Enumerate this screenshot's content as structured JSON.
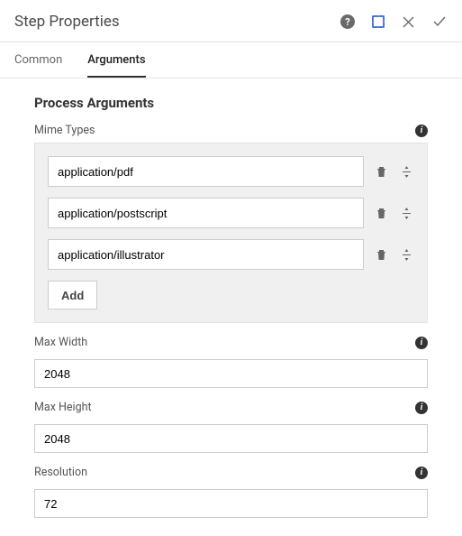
{
  "header": {
    "title": "Step Properties"
  },
  "tabs": {
    "common": "Common",
    "arguments": "Arguments"
  },
  "section": {
    "title": "Process Arguments"
  },
  "mimeTypes": {
    "label": "Mime Types",
    "items": [
      "application/pdf",
      "application/postscript",
      "application/illustrator"
    ],
    "addLabel": "Add"
  },
  "maxWidth": {
    "label": "Max Width",
    "value": "2048"
  },
  "maxHeight": {
    "label": "Max Height",
    "value": "2048"
  },
  "resolution": {
    "label": "Resolution",
    "value": "72"
  }
}
